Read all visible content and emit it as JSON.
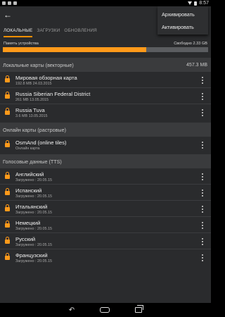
{
  "status_bar": {
    "time": "8:57"
  },
  "toolbar": {
    "back_icon": "arrow-back-icon"
  },
  "tabs": [
    {
      "label": "ЛОКАЛЬНЫЕ",
      "active": true
    },
    {
      "label": "ЗАГРУЗКИ",
      "active": false
    },
    {
      "label": "ОБНОВЛЕНИЯ",
      "active": false
    }
  ],
  "overflow_menu": {
    "items": [
      "Архивировать",
      "Активировать"
    ]
  },
  "storage": {
    "label": "Память устройства",
    "free_text": "Свободно 2.33 GB",
    "used_fraction": 0.7,
    "bar_color": "#ff9a1a"
  },
  "sections": {
    "vector": {
      "title": "Локальные карты (векторные)",
      "size": "457.3 MB"
    },
    "raster": {
      "title": "Онлайн карты (растровые)"
    },
    "voice": {
      "title": "Голосовые данные (TTS)"
    }
  },
  "vector_maps": [
    {
      "title": "Мировая обзорная карта",
      "sub": "192.8 MB  24.03.2015"
    },
    {
      "title": "Russia Siberian Federal District",
      "sub": "261 MB  13.05.2015"
    },
    {
      "title": "Russia Tuva",
      "sub": "3.6 MB  13.05.2015"
    }
  ],
  "raster_maps": [
    {
      "title": "OsmAnd (online tiles)",
      "sub": "Онлайн карта"
    }
  ],
  "voice_data": [
    {
      "title": "Английский",
      "sub": "Загружено : 20.05.15"
    },
    {
      "title": "Испанский",
      "sub": "Загружено : 20.05.15"
    },
    {
      "title": "Итальянский",
      "sub": "Загружено : 20.05.15"
    },
    {
      "title": "Немецкий",
      "sub": "Загружено : 20.05.15"
    },
    {
      "title": "Русский",
      "sub": "Загружено : 20.05.15"
    },
    {
      "title": "Французский",
      "sub": "Загружено : 20.05.15"
    }
  ],
  "accent_color": "#ff9a1a"
}
